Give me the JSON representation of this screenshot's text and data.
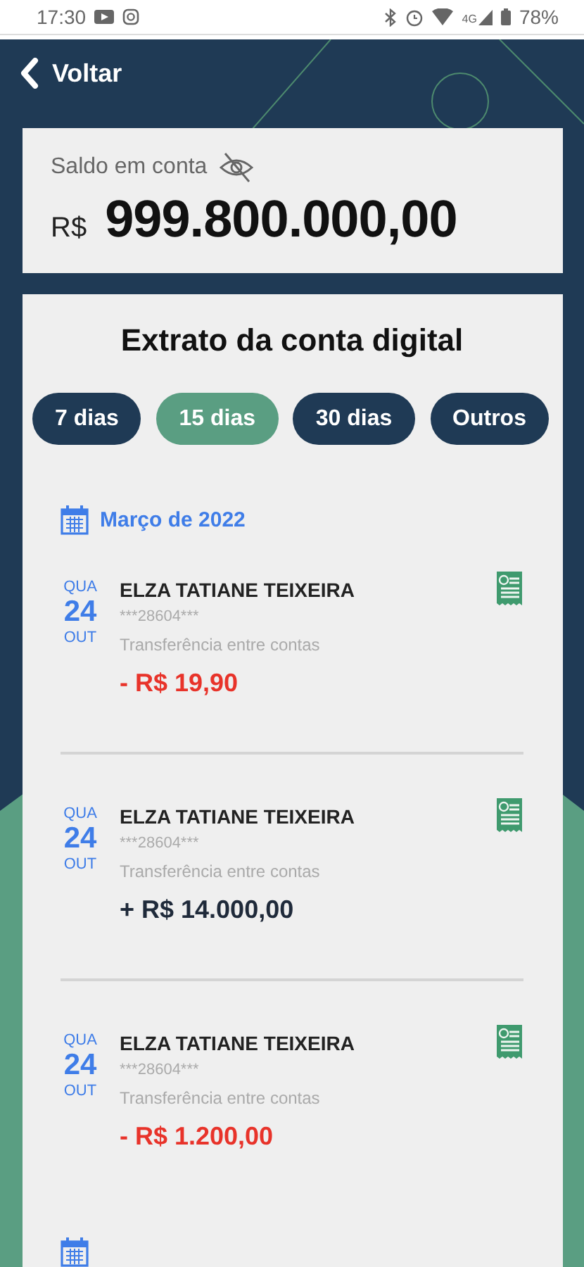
{
  "status_bar": {
    "time": "17:30",
    "network": "4G",
    "battery": "78%"
  },
  "header": {
    "back_label": "Voltar"
  },
  "balance": {
    "label": "Saldo em conta",
    "currency": "R$",
    "amount": "999.800.000,00"
  },
  "statement": {
    "title": "Extrato da conta digital",
    "filters": [
      {
        "label": "7 dias",
        "selected": false
      },
      {
        "label": "15 dias",
        "selected": true
      },
      {
        "label": "30 dias",
        "selected": false
      },
      {
        "label": "Outros",
        "selected": false
      }
    ],
    "months": [
      {
        "kind": "month",
        "label": "Março de 2022",
        "transactions": [
          {
            "weekday": "QUA",
            "day": "24",
            "month": "OUT",
            "name": "ELZA TATIANE TEIXEIRA",
            "account": "***28604***",
            "description": "Transferência entre contas",
            "amount": "- R$ 19,90",
            "kind": "debit"
          },
          {
            "weekday": "QUA",
            "day": "24",
            "month": "OUT",
            "name": "ELZA TATIANE TEIXEIRA",
            "account": "***28604***",
            "description": "Transferência entre contas",
            "amount": "+ R$ 14.000,00",
            "kind": "credit"
          },
          {
            "weekday": "QUA",
            "day": "24",
            "month": "OUT",
            "name": "ELZA TATIANE TEIXEIRA",
            "account": "***28604***",
            "description": "Transferência entre contas",
            "amount": "- R$ 1.200,00",
            "kind": "debit"
          }
        ]
      },
      {
        "kind": "calendar-only"
      }
    ]
  }
}
